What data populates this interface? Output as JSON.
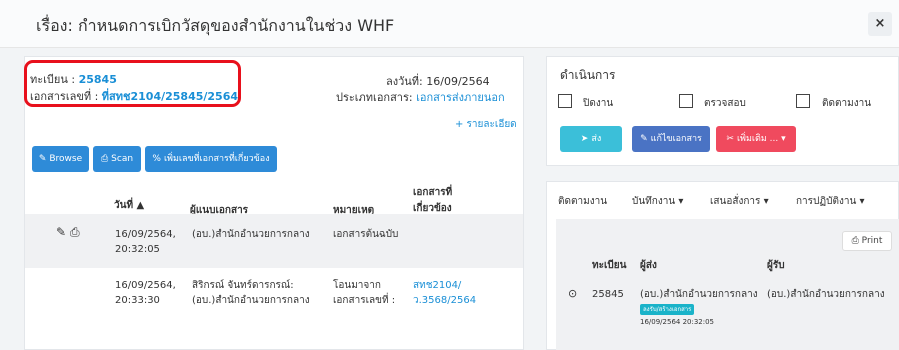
{
  "modal": {
    "title": "เรื่อง: กำหนดการเบิกวัสดุของสำนักงานในช่วง WHF",
    "close_label": "×"
  },
  "doc": {
    "reg_label": "ทะเบียน : ",
    "reg_value": "25845",
    "docno_label": "เอกสารเลขที่ : ",
    "docno_value": "ที่สทช2104/25845/2564",
    "date_text": "ลงวันที่: 16/09/2564",
    "type_label": "ประเภทเอกสาร: ",
    "type_value": "เอกสารส่งภายนอก",
    "details_link": "+ รายละเอียด"
  },
  "toolbar": {
    "browse_label": "Browse",
    "scan_label": "Scan",
    "add_related_label": "เพิ่มเลขที่เอกสารที่เกี่ยวข้อง"
  },
  "table": {
    "headers": {
      "date": "วันที่ ▲",
      "attacher": "ผู้แนบเอกสาร",
      "note": "หมายเหตุ",
      "related_1": "เอกสารที่",
      "related_2": "เกี่ยวข้อง"
    },
    "rows": [
      {
        "date_1": "16/09/2564,",
        "date_2": "20:32:05",
        "attacher": "(อบ.)สำนักอำนวยการกลาง",
        "note": "เอกสารต้นฉบับ"
      },
      {
        "date_1": "16/09/2564,",
        "date_2": "20:33:30",
        "attacher_1": "สิริกรณ์ จันทร์ดารกรณ์:",
        "attacher_2": "(อบ.)สำนักอำนวยการกลาง",
        "note_1": "โอนมาจาก",
        "note_2": "เอกสารเลขที่ :",
        "related_1": "สทช2104/",
        "related_2": "ว.3568/2564"
      }
    ]
  },
  "actions": {
    "title": "ดำเนินการ",
    "checkboxes": [
      "ปิดงาน",
      "ตรวจสอบ",
      "ติดตามงาน"
    ],
    "send_label": "ส่ง",
    "edit_label": "แก้ไขเอกสาร",
    "more_label": "เพิ่มเติม ..."
  },
  "history": {
    "tabs": [
      "ติดตามงาน",
      "บันทึกงาน ▾",
      "เสนอสั่งการ ▾",
      "การปฏิบัติงาน ▾"
    ],
    "print_label": "Print",
    "headers": {
      "reg": "ทะเบียน",
      "sender": "ผู้ส่ง",
      "receiver": "ผู้รับ"
    },
    "row": {
      "reg": "25845",
      "sender": "(อบ.)สำนักอำนวยการกลาง",
      "badge": "ลงรับ/สร้างเอกสาร",
      "timestamp": "16/09/2564 20:32:05",
      "receiver": "(อบ.)สำนักอำนวยการกลาง"
    }
  },
  "colors": {
    "accent": "#1a8fd6",
    "button_blue": "#2e8bd8",
    "button_teal": "#3bbfd9",
    "button_indigo": "#4a73c4",
    "button_red": "#f04a5e",
    "badge_teal": "#1ab3c9",
    "highlight_red": "#e8101c"
  }
}
